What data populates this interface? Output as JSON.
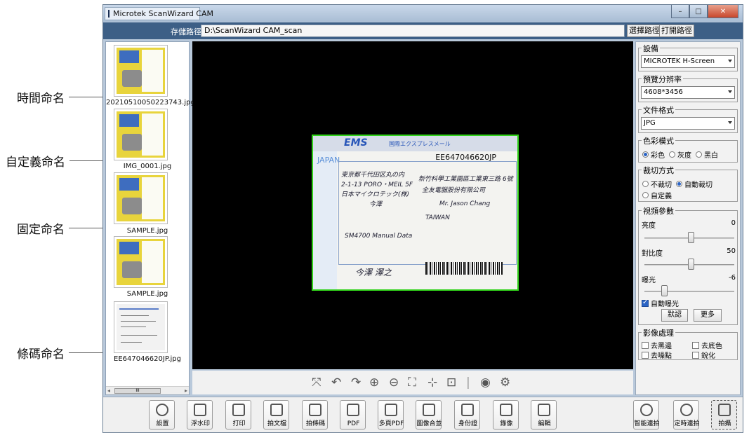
{
  "annotations": [
    "時間命名",
    "自定義命名",
    "固定命名",
    "條碼命名"
  ],
  "window": {
    "title": "Microtek ScanWizard CAM"
  },
  "pathbar": {
    "label": "存儲路徑:",
    "value": "D:\\ScanWizard CAM_scan",
    "select_btn": "選擇路徑",
    "open_btn": "打開路徑"
  },
  "thumbnails": [
    {
      "label": "20210510050223743.jpg",
      "kind": "book"
    },
    {
      "label": "IMG_0001.jpg",
      "kind": "book"
    },
    {
      "label": "SAMPLE.jpg",
      "kind": "book"
    },
    {
      "label": "SAMPLE.jpg",
      "kind": "book"
    },
    {
      "label": "EE647046620JP.jpg",
      "kind": "envelope"
    }
  ],
  "preview": {
    "ems": "EMS",
    "ems_sub": "国際エクスプレスメール",
    "tracking": "EE647046620JP",
    "side": "JAPAN",
    "handwriting": [
      "東京都千代田区丸の内",
      "2-1-13 PORO・MEIL 5F",
      "日本マイクロテック(株)",
      "今澤",
      "Mr. Jason Chang",
      "新竹科學工業園區工業東三路 6號",
      "全友電腦股份有限公司",
      "TAIWAN",
      "SM4700 Manual Data",
      "今澤 澤之"
    ]
  },
  "preview_tools": [
    "⤧",
    "↶",
    "↷",
    "⊕",
    "⊖",
    "⛶",
    "⊹",
    "⊡",
    "|",
    "◉",
    "⚙"
  ],
  "settings": {
    "device_title": "設備",
    "device_value": "MICROTEK H-Screen",
    "resolution_title": "預覽分辨率",
    "resolution_value": "4608*3456",
    "format_title": "文件格式",
    "format_value": "JPG",
    "color_title": "色彩模式",
    "color_options": [
      "彩色",
      "灰度",
      "黑白"
    ],
    "crop_title": "裁切方式",
    "crop_options": [
      "不裁切",
      "自動裁切",
      "自定義"
    ],
    "video_title": "視頻參數",
    "brightness_label": "亮度",
    "brightness_value": "0",
    "contrast_label": "對比度",
    "contrast_value": "50",
    "exposure_label": "曝光",
    "exposure_value": "-6",
    "auto_exposure": "自動曝光",
    "default_btn": "默認",
    "more_btn": "更多",
    "image_title": "影像處理",
    "image_opts": [
      "去黑邊",
      "去底色",
      "去噪點",
      "銳化"
    ]
  },
  "toolbar": [
    "設置",
    "浮水印",
    "打印",
    "拍文檔",
    "拍條碼",
    "PDF",
    "多頁PDF",
    "圖像合並",
    "身份證",
    "錄像",
    "編輯"
  ],
  "toolbar_right": [
    "智能連拍",
    "定時連拍",
    "拍攝"
  ]
}
